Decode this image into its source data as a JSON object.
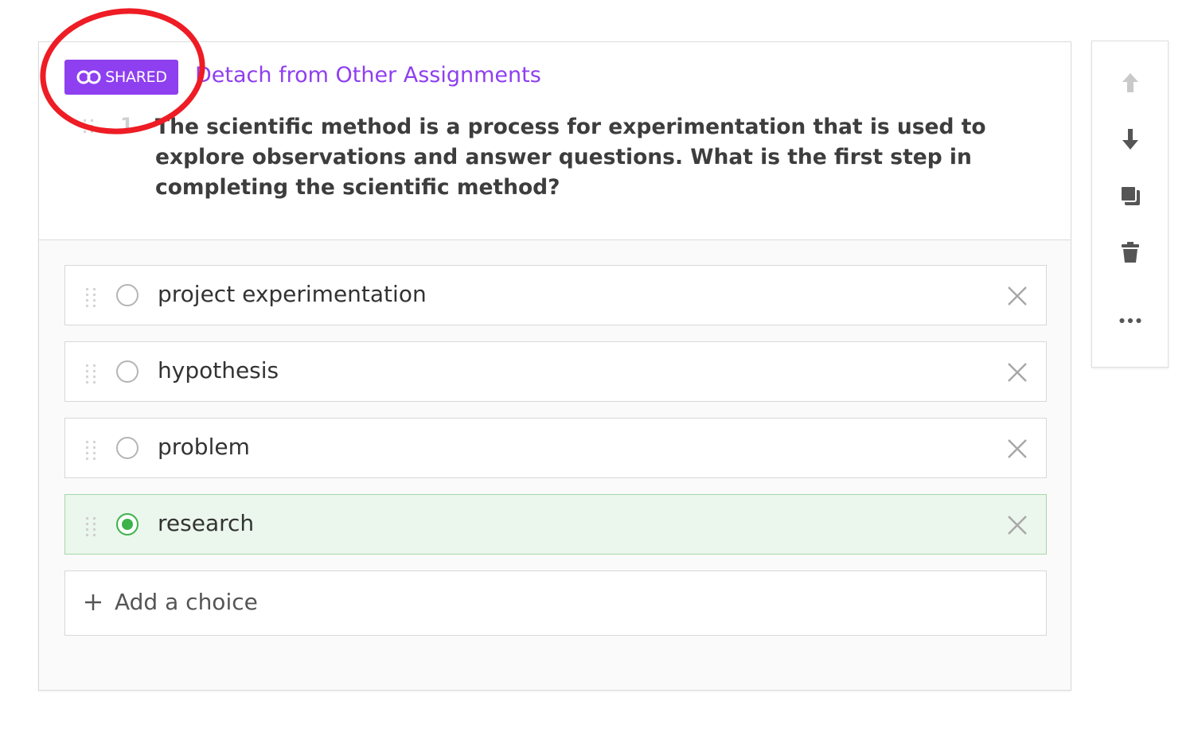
{
  "badge": {
    "label": "SHARED",
    "icon": "infinity-icon"
  },
  "detach_link": "Detach from Other Assignments",
  "question": {
    "number": "1",
    "text": "The scientific method is a process for experimentation that is used to explore observations and answer questions. What is the first step in completing the scientific method?"
  },
  "choices": [
    {
      "text": "project experimentation",
      "selected": false
    },
    {
      "text": "hypothesis",
      "selected": false
    },
    {
      "text": "problem",
      "selected": false
    },
    {
      "text": "research",
      "selected": true
    }
  ],
  "add_choice_label": "Add a choice",
  "toolbar": {
    "items": [
      "arrow-up-icon",
      "arrow-down-icon",
      "duplicate-icon",
      "trash-icon",
      "more-icon"
    ]
  },
  "colors": {
    "brand_purple": "#8e3ff0",
    "correct_green": "#3cb34a",
    "correct_bg": "#ebf6ec",
    "annotation_red": "#ee1c24"
  }
}
